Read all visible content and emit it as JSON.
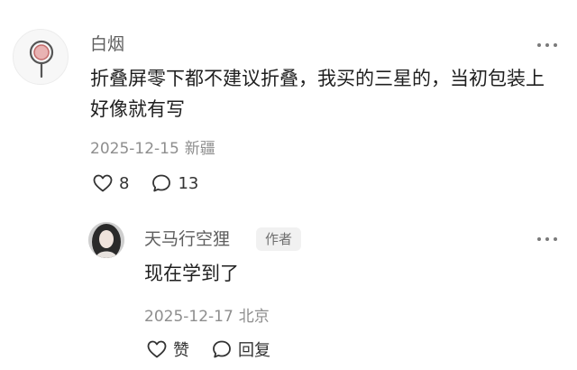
{
  "comments": [
    {
      "username": "白烟",
      "avatar_icon": "location-pin-icon",
      "text": "折叠屏零下都不建议折叠，我买的三星的，当初包装上好像就有写",
      "date": "2025-12-15",
      "location": "新疆",
      "likes": "8",
      "replies": "13"
    },
    {
      "username": "天马行空狸",
      "avatar_icon": "user-photo-icon",
      "author_badge": "作者",
      "text": "现在学到了",
      "date": "2025-12-17",
      "location": "北京",
      "like_label": "赞",
      "reply_label": "回复"
    }
  ],
  "colors": {
    "text_primary": "#1f1f1f",
    "text_secondary": "#8e8e8e",
    "pin_red": "#c46a6a"
  }
}
